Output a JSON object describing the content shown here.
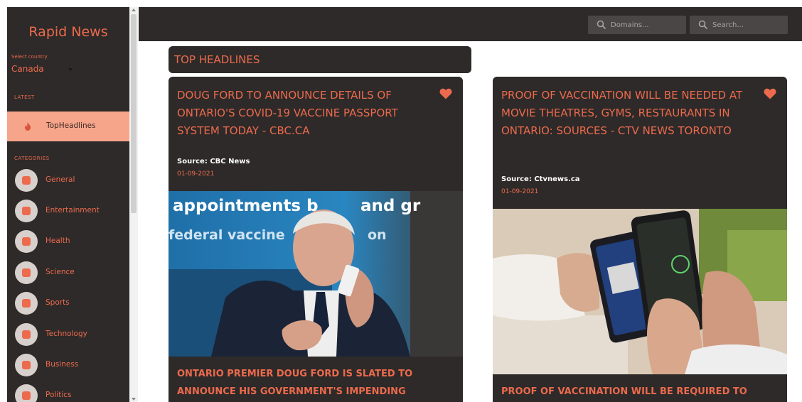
{
  "sidebar": {
    "brand": "Rapid News",
    "country_label": "Select country",
    "country_value": "Canada",
    "latest_label": "LATEST",
    "top_item_label": "TopHeadlines",
    "categories_label": "CATEGORIES",
    "categories": [
      {
        "label": "General",
        "icon": "general-icon"
      },
      {
        "label": "Entertainment",
        "icon": "entertainment-icon"
      },
      {
        "label": "Health",
        "icon": "health-icon"
      },
      {
        "label": "Science",
        "icon": "science-icon"
      },
      {
        "label": "Sports",
        "icon": "sports-icon"
      },
      {
        "label": "Technology",
        "icon": "technology-icon"
      },
      {
        "label": "Business",
        "icon": "business-icon"
      },
      {
        "label": "Politics",
        "icon": "politics-icon"
      }
    ]
  },
  "header": {
    "domains_placeholder": "Domains...",
    "search_placeholder": "Search..."
  },
  "main": {
    "section_title": "TOP HEADLINES",
    "cards": [
      {
        "title": "DOUG FORD TO ANNOUNCE DETAILS OF ONTARIO'S COVID-19 VACCINE PASSPORT SYSTEM TODAY - CBC.CA",
        "source": "Source: CBC News",
        "date": "01-09-2021",
        "description": "ONTARIO PREMIER DOUG FORD IS SLATED TO ANNOUNCE HIS GOVERNMENT'S IMPENDING",
        "image_overlay_lines": [
          "appointments b",
          "and gr",
          "federal vaccine",
          "on"
        ]
      },
      {
        "title": "PROOF OF VACCINATION WILL BE NEEDED AT MOVIE THEATRES, GYMS, RESTAURANTS IN ONTARIO: SOURCES - CTV NEWS TORONTO",
        "source": "Source: Ctvnews.ca",
        "date": "01-09-2021",
        "description": "PROOF OF VACCINATION WILL BE REQUIRED TO"
      }
    ]
  },
  "colors": {
    "accent": "#ec6a4d",
    "panel": "#2d2a29",
    "active_item": "#f7a58a"
  }
}
